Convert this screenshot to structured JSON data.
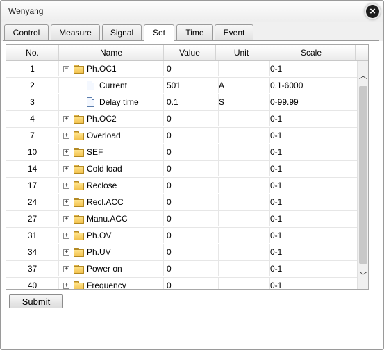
{
  "window": {
    "title": "Wenyang"
  },
  "tabs": [
    "Control",
    "Measure",
    "Signal",
    "Set",
    "Time",
    "Event"
  ],
  "active_tab": "Set",
  "table": {
    "columns": [
      "No.",
      "Name",
      "Value",
      "Unit",
      "Scale"
    ],
    "rows": [
      {
        "no": "1",
        "name": "Ph.OC1",
        "value": "0",
        "unit": "",
        "scale": "0-1",
        "kind": "group",
        "state": "expanded"
      },
      {
        "no": "2",
        "name": "Current",
        "value": "501",
        "unit": "A",
        "scale": "0.1-6000",
        "kind": "item"
      },
      {
        "no": "3",
        "name": "Delay time",
        "value": "0.1",
        "unit": "S",
        "scale": "0-99.99",
        "kind": "item"
      },
      {
        "no": "4",
        "name": "Ph.OC2",
        "value": "0",
        "unit": "",
        "scale": "0-1",
        "kind": "group",
        "state": "collapsed"
      },
      {
        "no": "7",
        "name": "Overload",
        "value": "0",
        "unit": "",
        "scale": "0-1",
        "kind": "group",
        "state": "collapsed"
      },
      {
        "no": "10",
        "name": "SEF",
        "value": "0",
        "unit": "",
        "scale": "0-1",
        "kind": "group",
        "state": "collapsed"
      },
      {
        "no": "14",
        "name": "Cold load",
        "value": "0",
        "unit": "",
        "scale": "0-1",
        "kind": "group",
        "state": "collapsed"
      },
      {
        "no": "17",
        "name": "Reclose",
        "value": "0",
        "unit": "",
        "scale": "0-1",
        "kind": "group",
        "state": "collapsed"
      },
      {
        "no": "24",
        "name": "Recl.ACC",
        "value": "0",
        "unit": "",
        "scale": "0-1",
        "kind": "group",
        "state": "collapsed"
      },
      {
        "no": "27",
        "name": "Manu.ACC",
        "value": "0",
        "unit": "",
        "scale": "0-1",
        "kind": "group",
        "state": "collapsed"
      },
      {
        "no": "31",
        "name": "Ph.OV",
        "value": "0",
        "unit": "",
        "scale": "0-1",
        "kind": "group",
        "state": "collapsed"
      },
      {
        "no": "34",
        "name": "Ph.UV",
        "value": "0",
        "unit": "",
        "scale": "0-1",
        "kind": "group",
        "state": "collapsed"
      },
      {
        "no": "37",
        "name": "Power on",
        "value": "0",
        "unit": "",
        "scale": "0-1",
        "kind": "group",
        "state": "collapsed"
      },
      {
        "no": "40",
        "name": "Frequency",
        "value": "0",
        "unit": "",
        "scale": "0-1",
        "kind": "group",
        "state": "collapsed"
      }
    ]
  },
  "submit_label": "Submit"
}
